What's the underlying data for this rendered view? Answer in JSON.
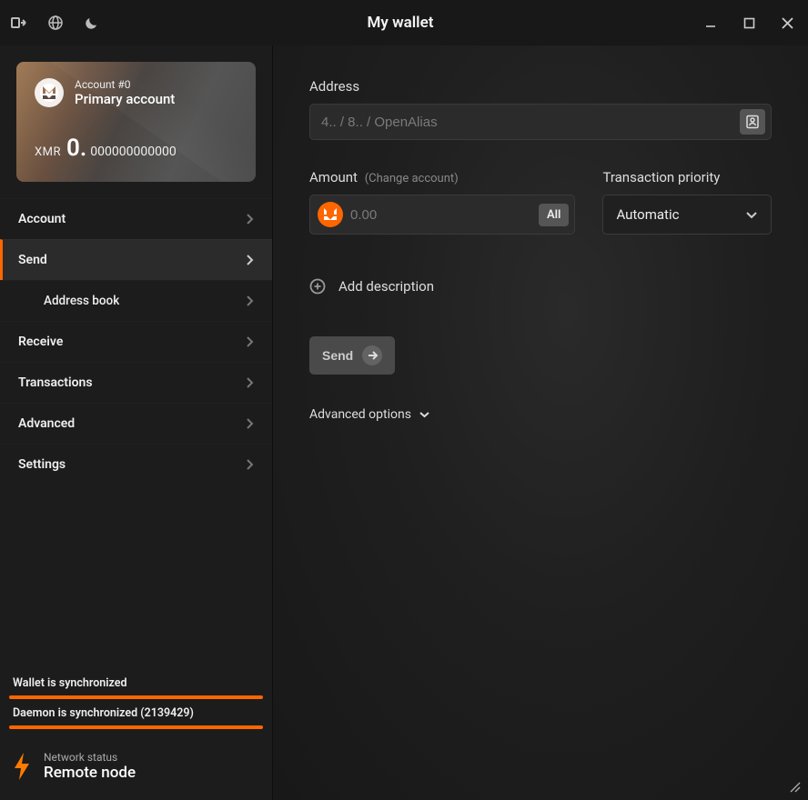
{
  "titlebar": {
    "title": "My wallet"
  },
  "account": {
    "label": "Account #0",
    "name": "Primary account",
    "currency": "XMR",
    "balance_int": "0.",
    "balance_dec": "000000000000"
  },
  "nav": {
    "account": "Account",
    "send": "Send",
    "address_book": "Address book",
    "receive": "Receive",
    "transactions": "Transactions",
    "advanced": "Advanced",
    "settings": "Settings"
  },
  "sync": {
    "wallet": "Wallet is synchronized",
    "daemon": "Daemon is synchronized (2139429)"
  },
  "network": {
    "label": "Network status",
    "value": "Remote node"
  },
  "form": {
    "address_label": "Address",
    "address_placeholder": "4.. / 8.. / OpenAlias",
    "amount_label": "Amount",
    "change_account": "(Change account)",
    "amount_placeholder": "0.00",
    "all_button": "All",
    "priority_label": "Transaction priority",
    "priority_value": "Automatic",
    "add_description": "Add description",
    "send_button": "Send",
    "advanced_options": "Advanced options"
  },
  "colors": {
    "accent": "#ff6600"
  }
}
